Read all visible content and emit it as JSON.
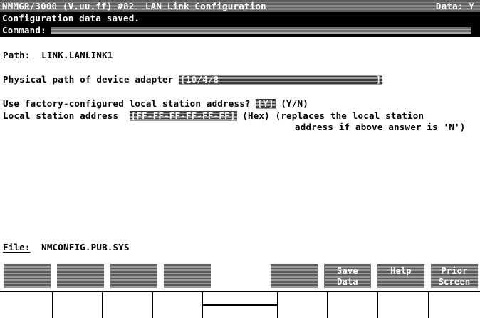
{
  "title_bar": {
    "title": "NMMGR/3000 (V.uu.ff) #82  LAN Link Configuration",
    "data_flag": "Data: Y"
  },
  "message": "Configuration data saved.",
  "command": {
    "label": "Command:",
    "value": ""
  },
  "path": {
    "label": "Path:",
    "value": "LINK.LANLINK1"
  },
  "physical_path": {
    "label": "Physical path of device adapter",
    "value": "10/4/8"
  },
  "factory_address": {
    "label": "Use factory-configured local station address?",
    "value": "Y",
    "hint": "(Y/N)"
  },
  "local_station": {
    "label": "Local station address",
    "value": "FF-FF-FF-FF-FF-FF",
    "hint_line1": "(Hex) (replaces the local station",
    "hint_line2": "address if above answer is 'N')"
  },
  "file": {
    "label": "File:",
    "value": "NMCONFIG.PUB.SYS"
  },
  "function_keys": [
    {
      "line1": "",
      "line2": ""
    },
    {
      "line1": "",
      "line2": ""
    },
    {
      "line1": "",
      "line2": ""
    },
    {
      "line1": "",
      "line2": ""
    },
    {
      "line1": "",
      "line2": ""
    },
    {
      "line1": "",
      "line2": ""
    },
    {
      "line1": "Save",
      "line2": "Data"
    },
    {
      "line1": "Help",
      "line2": ""
    },
    {
      "line1": "Prior",
      "line2": "Screen"
    }
  ]
}
